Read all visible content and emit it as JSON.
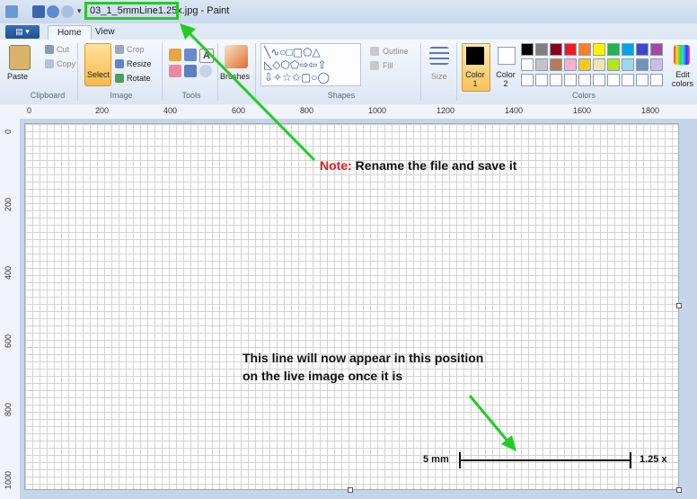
{
  "window": {
    "filename": "03_1_5mmLine1.25x.jpg",
    "app_name": "Paint"
  },
  "tabs": {
    "file": "▤ ▾",
    "home": "Home",
    "view": "View"
  },
  "ribbon": {
    "clipboard": {
      "paste": "Paste",
      "cut": "Cut",
      "copy": "Copy",
      "group": "Clipboard"
    },
    "image": {
      "select": "Select",
      "crop": "Crop",
      "resize": "Resize",
      "rotate": "Rotate",
      "group": "Image"
    },
    "tools": {
      "group": "Tools"
    },
    "brushes": {
      "label": "Brushes"
    },
    "shapes": {
      "outline": "Outline",
      "fill": "Fill",
      "group": "Shapes"
    },
    "size": {
      "label": "Size"
    },
    "colors": {
      "color1": "Color 1",
      "color2": "Color 2",
      "edit": "Edit colors",
      "group": "Colors",
      "palette_row1": [
        "#000000",
        "#7f7f7f",
        "#880015",
        "#ed1c24",
        "#ff7f27",
        "#fff200",
        "#22b14c",
        "#00a2e8",
        "#3f48cc",
        "#a349a4"
      ],
      "palette_row2": [
        "#ffffff",
        "#c3c3c3",
        "#b97a57",
        "#ffaec9",
        "#ffc90e",
        "#efe4b0",
        "#b5e61d",
        "#99d9ea",
        "#7092be",
        "#c8bfe7"
      ]
    }
  },
  "rulers": {
    "horizontal": [
      "0",
      "200",
      "400",
      "600",
      "800",
      "1000",
      "1200",
      "1400",
      "1600",
      "1800"
    ],
    "vertical": [
      "0",
      "200",
      "400",
      "600",
      "800",
      "1000"
    ]
  },
  "canvas": {
    "note_label": "Note:",
    "note_text": " Rename the file and save it",
    "line_text": "This line will now appear in this position on the live image once it is",
    "scale_left": "5 mm",
    "scale_right": "1.25 x"
  },
  "colors": {
    "annotation_green": "#22cc22",
    "note_red": "#e02020"
  }
}
